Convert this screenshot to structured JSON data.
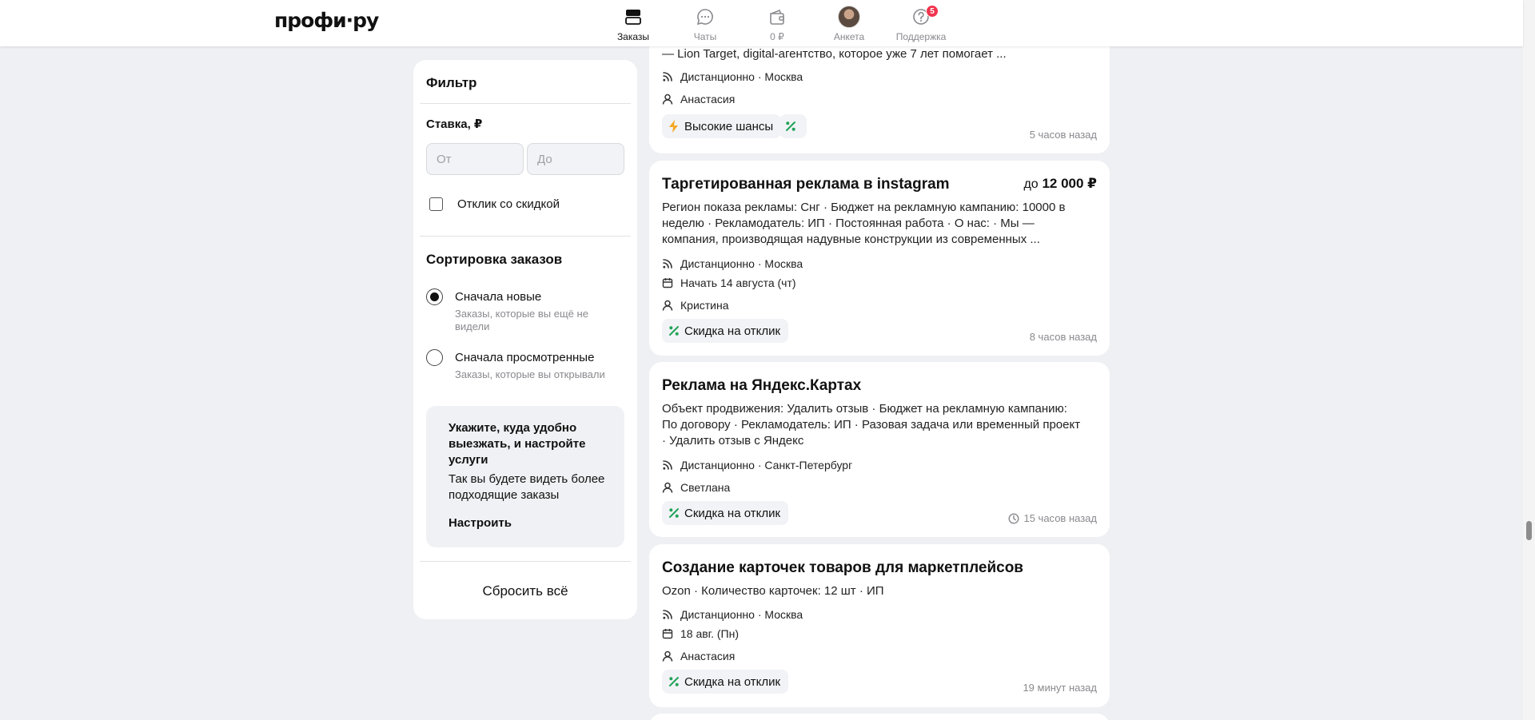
{
  "app": {
    "logo": "профи·ру"
  },
  "nav": {
    "items": [
      {
        "label": "Заказы",
        "icon": "orders-icon",
        "active": true
      },
      {
        "label": "Чаты",
        "icon": "chat-icon"
      },
      {
        "label": "0 ₽",
        "icon": "wallet-icon"
      },
      {
        "label": "Анкета",
        "icon": "avatar"
      },
      {
        "label": "Поддержка",
        "icon": "help-icon",
        "badge": "5"
      }
    ]
  },
  "filter": {
    "title": "Фильтр",
    "rate_label": "Ставка, ₽",
    "rate_from_placeholder": "От",
    "rate_to_placeholder": "До",
    "discount_checkbox": "Отклик со скидкой",
    "sort_title": "Сортировка заказов",
    "sort_options": [
      {
        "label": "Сначала новые",
        "hint": "Заказы, которые вы ещё не видели",
        "selected": true
      },
      {
        "label": "Сначала просмотренные",
        "hint": "Заказы, которые вы открывали",
        "selected": false
      }
    ],
    "promo": {
      "title": "Укажите, куда удобно выезжать, и настройте услуги",
      "text": "Так вы будете видеть более подходящие заказы",
      "link": "Настроить"
    },
    "reset": "Сбросить всё"
  },
  "orders": [
    {
      "desc": "— Lion Target, digital-агентство, которое уже 7 лет помогает ...",
      "location": "Дистанционно · Москва",
      "client": "Анастасия",
      "tag": "Высокие шансы",
      "time": "5 часов назад"
    },
    {
      "title": "Таргетированная реклама в instagram",
      "price_prefix": "до",
      "price": "12 000 ₽",
      "desc": "Регион показа рекламы: Снг · Бюджет на рекламную кампанию: 10000 в неделю · Рекламодатель: ИП · Постоянная работа · О нас: · Мы — компания, производящая надувные конструкции из современных ...",
      "location": "Дистанционно · Москва",
      "date": "Начать 14 августа (чт)",
      "client": "Кристина",
      "tag": "Скидка на отклик",
      "time": "8 часов назад"
    },
    {
      "title": "Реклама на Яндекс.Картах",
      "desc": "Объект продвижения: Удалить отзыв · Бюджет на рекламную кампанию: По договору · Рекламодатель: ИП · Разовая задача или временный проект · Удалить отзыв с Яндекс",
      "location": "Дистанционно · Санкт-Петербург",
      "client": "Светлана",
      "tag": "Скидка на отклик",
      "time": "15 часов назад"
    },
    {
      "title": "Создание карточек товаров для маркетплейсов",
      "desc": "Ozon · Количество карточек: 12 шт · ИП",
      "location": "Дистанционно · Москва",
      "date": "18 авг. (Пн)",
      "client": "Анастасия",
      "tag": "Скидка на отклик",
      "time": "19 минут назад"
    }
  ],
  "colors": {
    "accent_green": "#22a35a",
    "lightning": "#f5a623",
    "badge_red": "#f1344e",
    "background": "#eff0f3"
  }
}
